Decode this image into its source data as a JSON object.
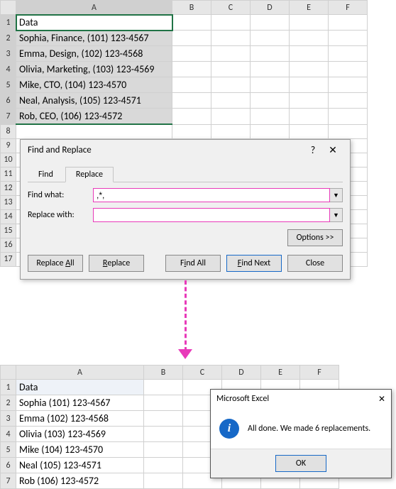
{
  "sheet1": {
    "cols": [
      "A",
      "B",
      "C",
      "D",
      "E",
      "F"
    ],
    "rows": [
      "1",
      "2",
      "3",
      "4",
      "5",
      "6",
      "7",
      "8",
      "9",
      "10",
      "11",
      "12",
      "13",
      "14",
      "15",
      "16",
      "17"
    ],
    "header": "Data",
    "data": [
      "Sophia, Finance, (101) 123-4567",
      "Emma, Design, (102) 123-4568",
      "Olivia, Marketing, (103) 123-4569",
      "Mike, CTO, (104) 123-4570",
      "Neal, Analysis, (105) 123-4571",
      "Rob, CEO, (106) 123-4572"
    ]
  },
  "dialog": {
    "title": "Find and Replace",
    "help": "?",
    "close": "✕",
    "tabs": {
      "find": "Find",
      "replace": "Replace"
    },
    "findwhat_label": "Find what:",
    "findwhat_value": ",*,",
    "replacewith_label": "Replace with:",
    "replacewith_value": "",
    "options": "Options >>",
    "buttons": {
      "replaceall": "Replace All",
      "replace": "Replace",
      "findall": "Find All",
      "findnext": "Find Next",
      "close": "Close"
    }
  },
  "sheet2": {
    "cols": [
      "A",
      "B",
      "C",
      "D",
      "E",
      "F"
    ],
    "rows": [
      "1",
      "2",
      "3",
      "4",
      "5",
      "6",
      "7"
    ],
    "header": "Data",
    "data": [
      "Sophia (101) 123-4567",
      "Emma (102) 123-4568",
      "Olivia (103) 123-4569",
      "Mike (104) 123-4570",
      "Neal (105) 123-4571",
      "Rob (106) 123-4572"
    ]
  },
  "msgbox": {
    "title": "Microsoft Excel",
    "close": "✕",
    "info": "i",
    "message": "All done. We made 6 replacements.",
    "ok": "OK"
  },
  "colwidths1": {
    "A": 220,
    "B": 55,
    "C": 55,
    "D": 55,
    "E": 55,
    "F": 55
  },
  "colwidths2": {
    "A": 180,
    "B": 55,
    "C": 55,
    "D": 55,
    "E": 55,
    "F": 55
  }
}
